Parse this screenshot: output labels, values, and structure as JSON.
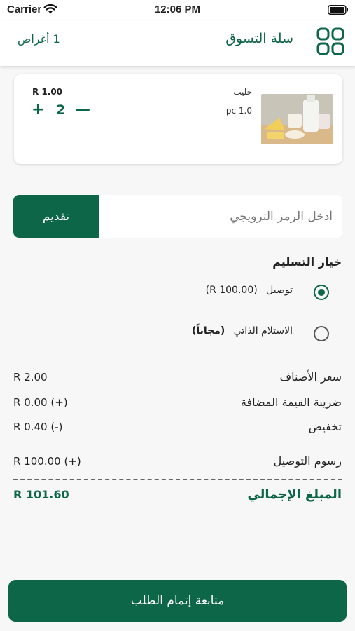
{
  "status_bar": {
    "carrier": "Carrier",
    "time": "12:06 PM"
  },
  "header": {
    "title": "سلة التسوق",
    "items_count": "1 أغراض"
  },
  "cart_item": {
    "name": "حليب",
    "unit": "pc 1.0",
    "price": "R 1.00",
    "quantity": "2",
    "plus": "+",
    "minus": "—"
  },
  "promo": {
    "placeholder": "أدخل الرمز الترويجي",
    "apply_label": "تقديم"
  },
  "delivery": {
    "heading": "خيار التسليم",
    "options": [
      {
        "label": "توصيل",
        "note": "(R 100.00)",
        "selected": true
      },
      {
        "label": "الاستلام الذاتي",
        "note": "(مجاناً)",
        "selected": false
      }
    ]
  },
  "summary": {
    "items_price_label": "سعر الأصناف",
    "items_price_value": "R 2.00",
    "vat_label": "ضريبة القيمة المضافة",
    "vat_value": "R 0.00 (+)",
    "discount_label": "تخفيض",
    "discount_value": "R 0.40 (-)",
    "delivery_fee_label": "رسوم التوصيل",
    "delivery_fee_value": "R 100.00 (+)",
    "total_label": "المبلغ الإجمالي",
    "total_value": "R 101.60"
  },
  "checkout_label": "متابعة إتمام الطلب",
  "colors": {
    "accent": "#0e6648",
    "background": "#f7f7f7"
  },
  "icons": {
    "menu": "grid-icon",
    "wifi": "wifi-icon",
    "battery": "battery-icon"
  }
}
